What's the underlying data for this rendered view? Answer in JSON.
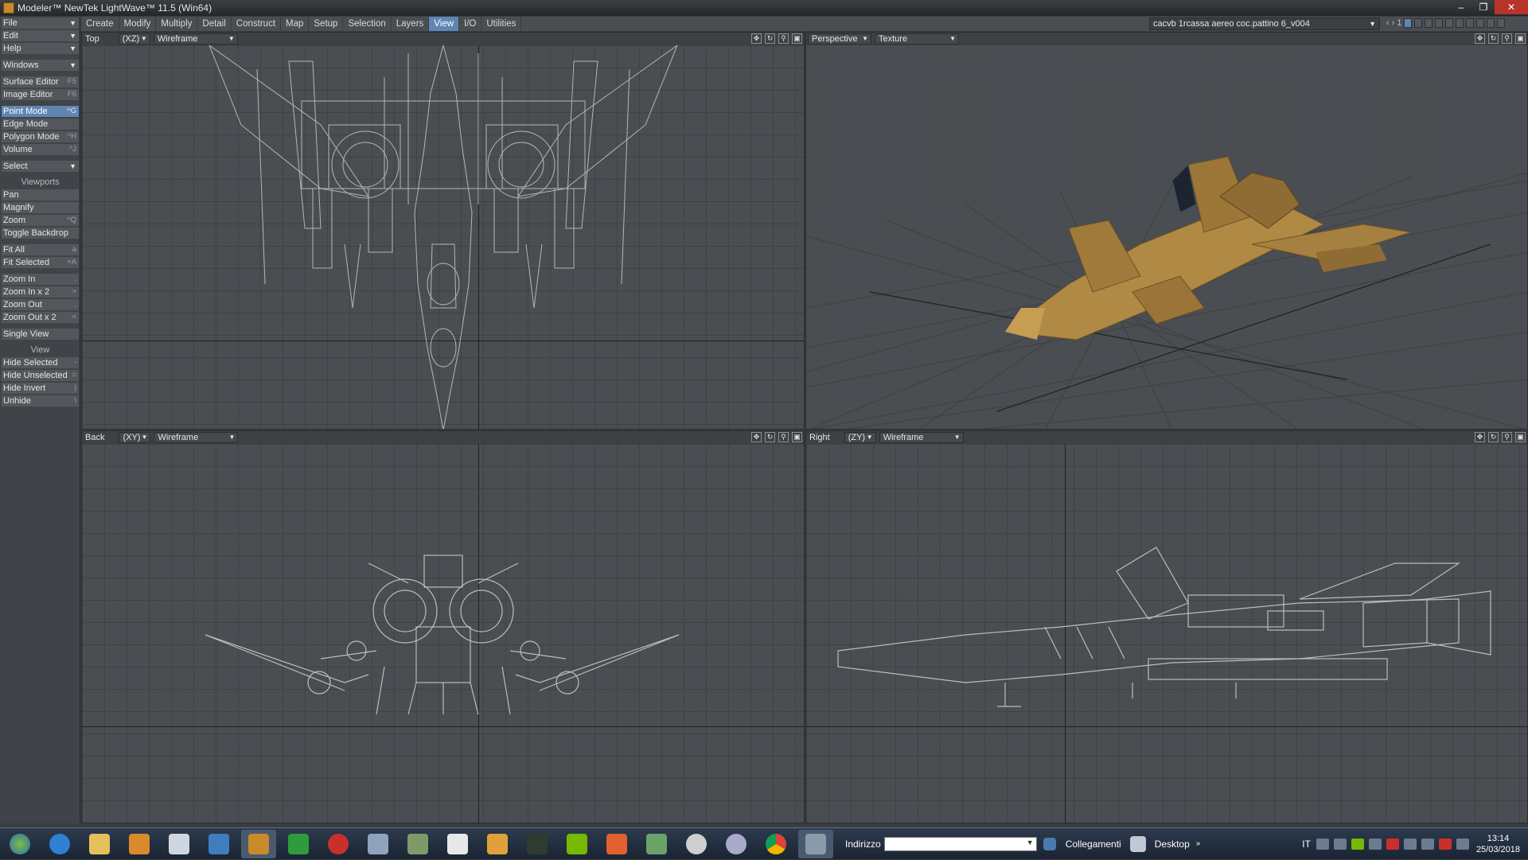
{
  "window": {
    "title": "Modeler™ NewTek LightWave™ 11.5 (Win64)"
  },
  "menubar": {
    "tabs": [
      "Create",
      "Modify",
      "Multiply",
      "Detail",
      "Construct",
      "Map",
      "Setup",
      "Selection",
      "Layers",
      "View",
      "I/O",
      "Utilities"
    ],
    "active_tab": "View",
    "scene_select": "cacvb 1rcassa aereo  coc.pattino 6_v004",
    "layer_number": "1"
  },
  "sidebar": {
    "file": "File",
    "edit": "Edit",
    "help": "Help",
    "windows": "Windows",
    "surface_editor": "Surface Editor",
    "surface_editor_sc": "F5",
    "image_editor": "Image Editor",
    "image_editor_sc": "F6",
    "point_mode": "Point Mode",
    "point_mode_sc": "^G",
    "edge_mode": "Edge Mode",
    "polygon_mode": "Polygon Mode",
    "polygon_mode_sc": "^H",
    "volume": "Volume",
    "volume_sc": "^J",
    "select": "Select",
    "viewports_head": "Viewports",
    "pan": "Pan",
    "magnify": "Magnify",
    "zoom": "Zoom",
    "zoom_sc": "^Q",
    "toggle_backdrop": "Toggle Backdrop",
    "fit_all": "Fit All",
    "fit_all_sc": "a",
    "fit_selected": "Fit Selected",
    "fit_selected_sc": "+A",
    "zoom_in": "Zoom In",
    "zoom_in_sc": ".",
    "zoom_in_x2": "Zoom In x 2",
    "zoom_in_x2_sc": ">",
    "zoom_out": "Zoom Out",
    "zoom_out_sc": ",",
    "zoom_out_x2": "Zoom Out x 2",
    "zoom_out_x2_sc": "<",
    "single_view": "Single View",
    "view_head": "View",
    "hide_selected": "Hide Selected",
    "hide_selected_sc": "-",
    "hide_unselected": "Hide Unselected",
    "hide_unselected_sc": "=",
    "hide_invert": "Hide Invert",
    "hide_invert_sc": "|",
    "unhide": "Unhide",
    "unhide_sc": "\\"
  },
  "viewports": {
    "top": {
      "view": "Top",
      "axes": "(XZ)",
      "mode": "Wireframe"
    },
    "perspective": {
      "view": "Perspective",
      "mode": "Texture"
    },
    "back": {
      "view": "Back",
      "axes": "(XY)",
      "mode": "Wireframe"
    },
    "right": {
      "view": "Right",
      "axes": "(ZY)",
      "mode": "Wireframe"
    }
  },
  "taskbar": {
    "address_label": "Indirizzo",
    "links_label": "Collegamenti",
    "desktop_label": "Desktop",
    "lang": "IT",
    "time": "13:14",
    "date": "25/03/2018"
  },
  "colors": {
    "accent": "#5f86b3",
    "viewport_bg": "#4a4d51",
    "model_texture": "#b08a45"
  }
}
